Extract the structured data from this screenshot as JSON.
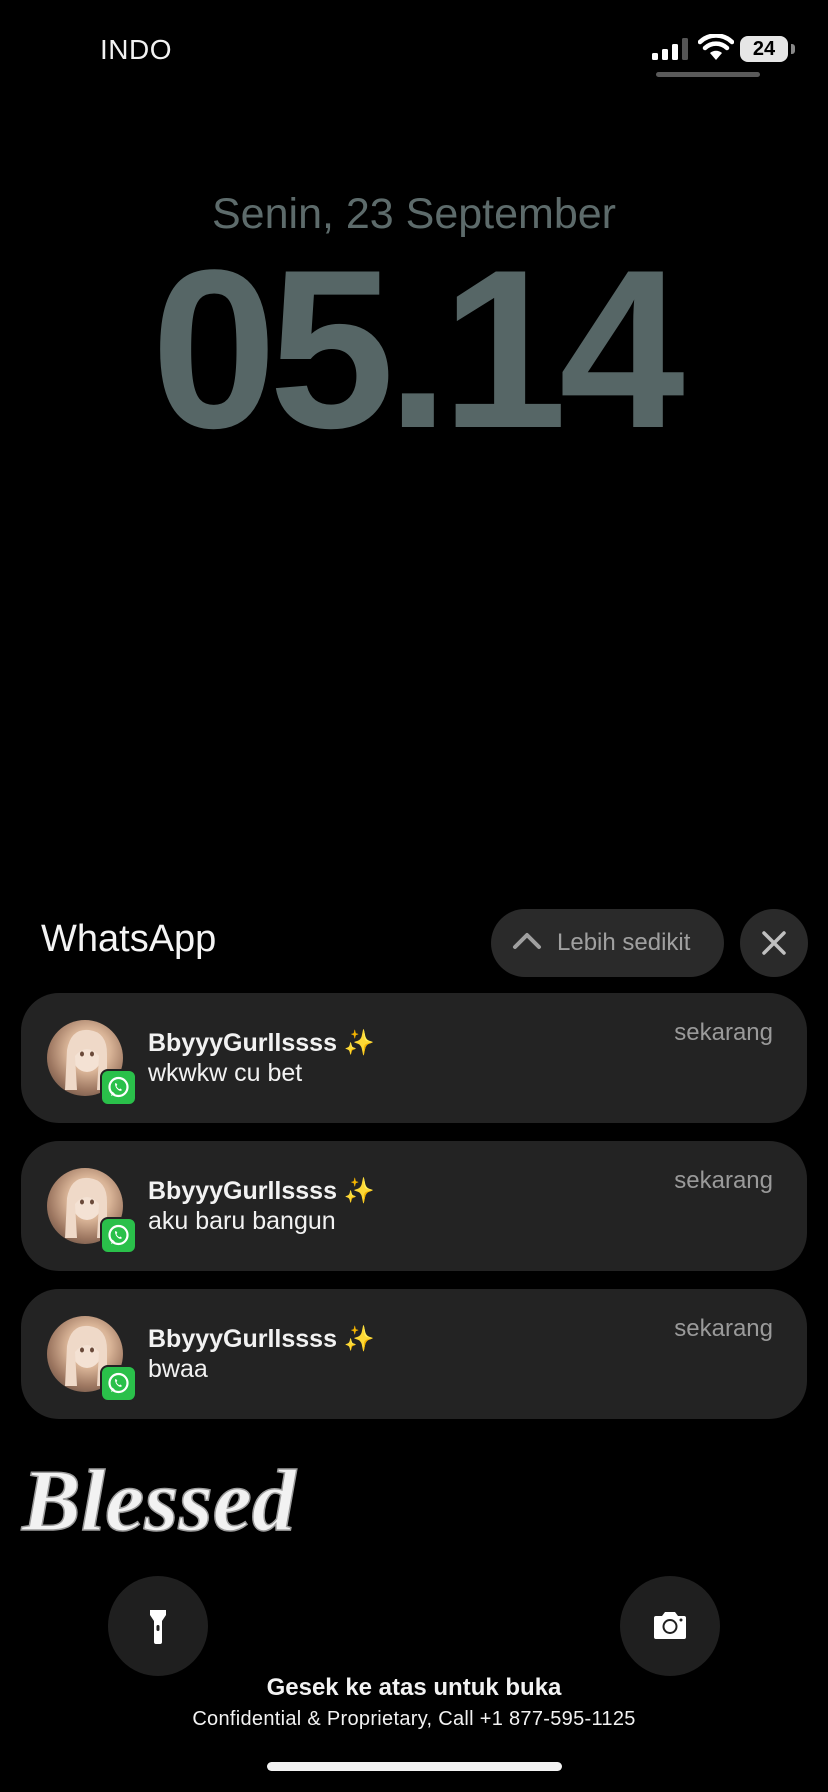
{
  "status_bar": {
    "carrier": "INDO",
    "battery_level": "24",
    "signal_icon": "cellular-signal-icon",
    "wifi_icon": "wifi-icon"
  },
  "lock_screen": {
    "date": "Senin, 23 September",
    "time": "05.14",
    "wallpaper_text": "Blessed",
    "unlock_hint": "Gesek ke atas untuk buka",
    "footer_note": "Confidential & Proprietary, Call +1 877-595-1125"
  },
  "notification_group": {
    "app_name": "WhatsApp",
    "show_less_label": "Lebih sedikit",
    "close_icon": "close-icon",
    "notifications": [
      {
        "sender": "BbyyyGurllssss ✨",
        "message": "wkwkw cu bet",
        "time": "sekarang"
      },
      {
        "sender": "BbyyyGurllssss ✨",
        "message": "aku baru bangun",
        "time": "sekarang"
      },
      {
        "sender": "BbyyyGurllssss ✨",
        "message": "bwaa",
        "time": "sekarang"
      }
    ]
  },
  "quick_actions": {
    "flashlight_icon": "flashlight-icon",
    "camera_icon": "camera-icon"
  },
  "colors": {
    "background": "#000000",
    "clock": "#566666",
    "notification_card": "#232323",
    "whatsapp_green": "#2ac04a"
  }
}
